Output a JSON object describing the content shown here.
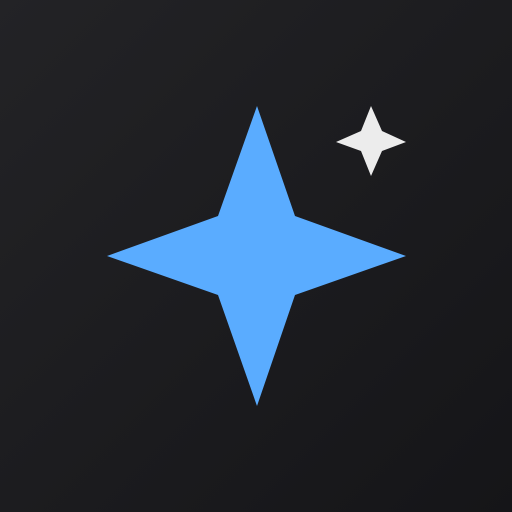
{
  "icon": {
    "name": "sparkle-icon",
    "colors": {
      "background_top": "#232326",
      "background_bottom": "#151518",
      "primary_star": "#5aacff",
      "secondary_star": "#ececec"
    }
  }
}
